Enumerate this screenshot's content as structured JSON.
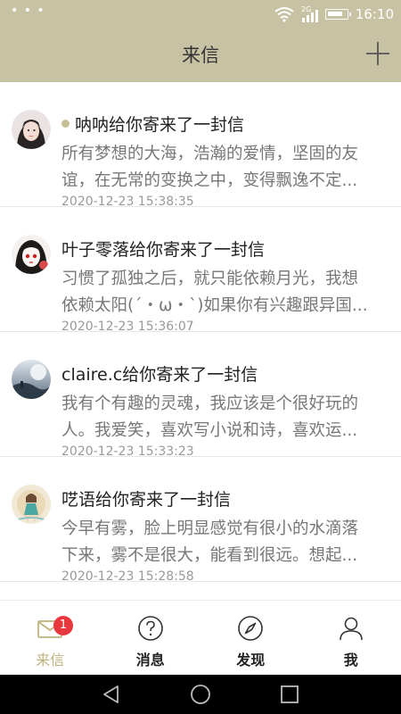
{
  "status_bar": {
    "time": "16:10",
    "network": "2G",
    "icons": [
      "more-dots-icon",
      "wifi-icon",
      "signal-icon",
      "battery-icon"
    ]
  },
  "header": {
    "title": "来信",
    "add_icon": "plus-icon"
  },
  "letters": [
    {
      "sender_line": "呐呐给你寄来了一封信",
      "unread": true,
      "preview_lines": [
        "所有梦想的大海，浩瀚的爱情，坚固的友",
        "谊，在无常的变换之中，变得飘逸不定..."
      ],
      "time": "2020-12-23 15:38:35"
    },
    {
      "sender_line": "叶子零落给你寄来了一封信",
      "unread": false,
      "preview_lines": [
        "习惯了孤独之后，就只能依赖月光，我想",
        "依赖太阳(´・ω・`)如果你有兴趣跟异国..."
      ],
      "time": "2020-12-23 15:36:07"
    },
    {
      "sender_line": "claire.c给你寄来了一封信",
      "unread": false,
      "preview_lines": [
        "我有个有趣的灵魂，我应该是个很好玩的",
        "人。我爱笑，喜欢写小说和诗，喜欢运..."
      ],
      "time": "2020-12-23 15:33:23"
    },
    {
      "sender_line": "呓语给你寄来了一封信",
      "unread": false,
      "preview_lines": [
        "今早有雾，脸上明显感觉有很小的水滴落",
        "下来，雾不是很大，能看到很远。想起..."
      ],
      "time": "2020-12-23 15:28:58"
    }
  ],
  "tabs": [
    {
      "label": "来信",
      "icon": "envelope-icon",
      "badge": "1",
      "active": true
    },
    {
      "label": "消息",
      "icon": "question-circle-icon",
      "active": false
    },
    {
      "label": "发现",
      "icon": "compass-icon",
      "active": false
    },
    {
      "label": "我",
      "icon": "person-icon",
      "active": false
    }
  ],
  "colors": {
    "header_bg": "#c7c2a4",
    "accent": "#c0b27c",
    "badge": "#e8383d",
    "unread_dot": "#c9bf96"
  },
  "system_nav": [
    "back-icon",
    "home-icon",
    "recents-icon"
  ]
}
